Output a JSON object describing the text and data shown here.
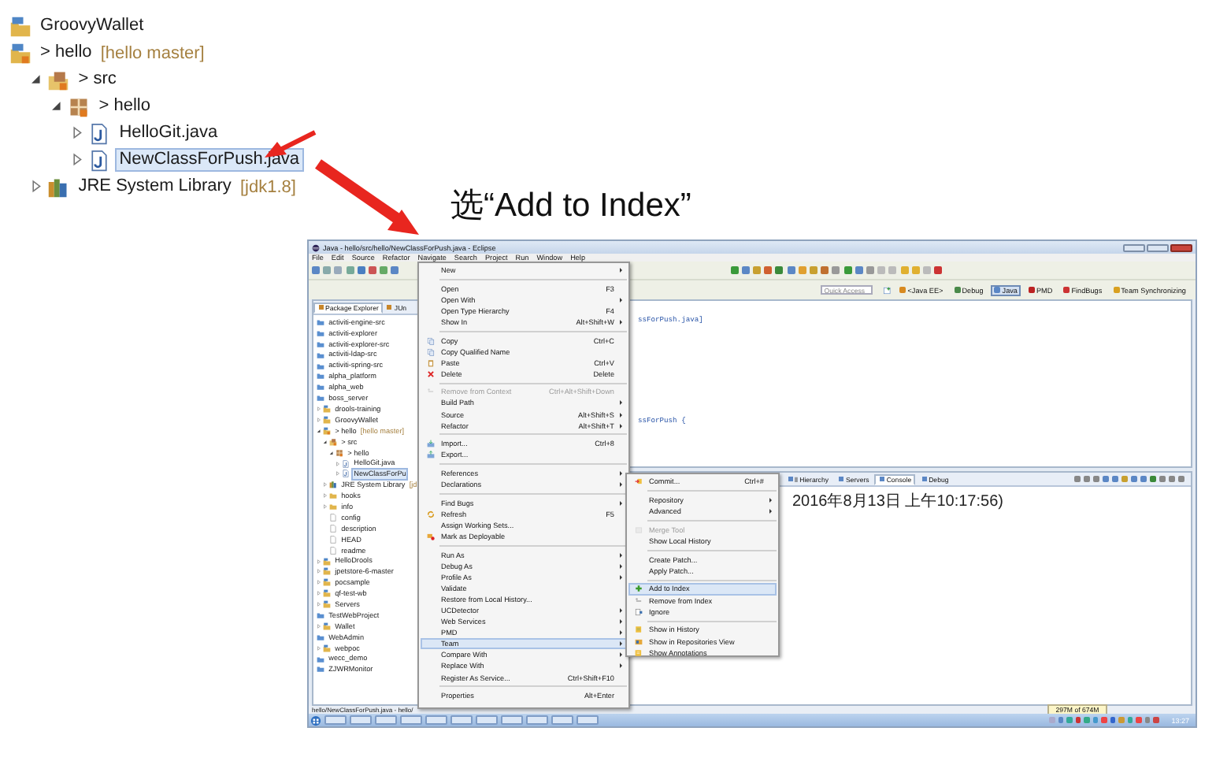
{
  "tree": [
    {
      "kind": "project",
      "label": "GroovyWallet",
      "selected": false
    },
    {
      "kind": "git-project",
      "label": "> hello",
      "decoration": "[hello master]",
      "selected": false,
      "children": [
        {
          "kind": "source-folder",
          "label": "> src",
          "expanded": true,
          "selected": false,
          "children": [
            {
              "kind": "package",
              "label": "> hello",
              "expanded": true,
              "selected": false,
              "children": [
                {
                  "kind": "java-file",
                  "label": "HelloGit.java",
                  "expanded": false,
                  "selected": false
                },
                {
                  "kind": "java-file",
                  "label": "NewClassForPush.java",
                  "expanded": false,
                  "selected": true
                }
              ]
            }
          ]
        },
        {
          "kind": "library",
          "label": "JRE System Library",
          "decoration": "[jdk1.8]",
          "expanded": false,
          "selected": false
        }
      ]
    }
  ],
  "caption": "选“Add to Index”",
  "eclipse": {
    "title": "Java - hello/src/hello/NewClassForPush.java - Eclipse",
    "menubar": [
      "File",
      "Edit",
      "Source",
      "Refactor",
      "Navigate",
      "Search",
      "Project",
      "Run",
      "Window",
      "Help"
    ],
    "quick_access": {
      "placeholder": "Quick Access"
    },
    "perspectives": [
      {
        "label": "<Java EE>",
        "selected": false
      },
      {
        "label": "Debug",
        "selected": false
      },
      {
        "label": "Java",
        "selected": true
      },
      {
        "label": "PMD",
        "selected": false
      },
      {
        "label": "FindBugs",
        "selected": false
      },
      {
        "label": "Team Synchronizing",
        "selected": false
      }
    ],
    "explorer_tabs": [
      {
        "label": "Package Explorer",
        "selected": true
      },
      {
        "label": "JUn",
        "selected": false
      }
    ],
    "explorer": [
      {
        "kind": "closed-project",
        "label": "activiti-engine-src",
        "selected": false
      },
      {
        "kind": "closed-project",
        "label": "activiti-explorer",
        "selected": false
      },
      {
        "kind": "closed-project",
        "label": "activiti-explorer-src",
        "selected": false
      },
      {
        "kind": "closed-project",
        "label": "activiti-ldap-src",
        "selected": false
      },
      {
        "kind": "closed-project",
        "label": "activiti-spring-src",
        "selected": false
      },
      {
        "kind": "closed-project",
        "label": "alpha_platform",
        "selected": false
      },
      {
        "kind": "closed-project",
        "label": "alpha_web",
        "selected": false
      },
      {
        "kind": "closed-project",
        "label": "boss_server",
        "selected": false
      },
      {
        "kind": "project",
        "label": "drools-training",
        "expanded": false,
        "selected": false
      },
      {
        "kind": "project",
        "label": "GroovyWallet",
        "expanded": false,
        "selected": false
      },
      {
        "kind": "git-project",
        "label": "> hello",
        "decoration": "[hello master]",
        "expanded": true,
        "selected": false,
        "children": [
          {
            "kind": "source-folder",
            "label": "> src",
            "expanded": true,
            "selected": false,
            "children": [
              {
                "kind": "package",
                "label": "> hello",
                "expanded": true,
                "selected": false,
                "children": [
                  {
                    "kind": "java-file",
                    "label": "HelloGit.java",
                    "expanded": false,
                    "selected": false
                  },
                  {
                    "kind": "java-file",
                    "label": "NewClassForPu",
                    "expanded": false,
                    "selected": true
                  }
                ]
              }
            ]
          },
          {
            "kind": "library",
            "label": "JRE System Library",
            "decoration": "[jd",
            "expanded": false,
            "selected": false
          },
          {
            "kind": "folder",
            "label": "hooks",
            "expanded": false,
            "selected": false
          },
          {
            "kind": "folder",
            "label": "info",
            "expanded": false,
            "selected": false
          },
          {
            "kind": "file",
            "label": "config",
            "selected": false
          },
          {
            "kind": "file",
            "label": "description",
            "selected": false
          },
          {
            "kind": "file",
            "label": "HEAD",
            "selected": false
          },
          {
            "kind": "file",
            "label": "readme",
            "selected": false
          }
        ]
      },
      {
        "kind": "project",
        "label": "HelloDrools",
        "expanded": false,
        "selected": false
      },
      {
        "kind": "project",
        "label": "jpetstore-6-master",
        "expanded": false,
        "selected": false
      },
      {
        "kind": "project",
        "label": "pocsample",
        "expanded": false,
        "selected": false
      },
      {
        "kind": "project",
        "label": "qf-test-wb",
        "expanded": false,
        "selected": false
      },
      {
        "kind": "project",
        "label": "Servers",
        "expanded": false,
        "selected": false
      },
      {
        "kind": "closed-project",
        "label": "TestWebProject",
        "selected": false
      },
      {
        "kind": "project",
        "label": "Wallet",
        "expanded": false,
        "selected": false
      },
      {
        "kind": "closed-project",
        "label": "WebAdmin",
        "selected": false
      },
      {
        "kind": "project",
        "label": "webpoc",
        "expanded": false,
        "selected": false
      },
      {
        "kind": "closed-project",
        "label": "wecc_demo",
        "selected": false
      },
      {
        "kind": "closed-project",
        "label": "ZJWRMonitor",
        "selected": false
      }
    ],
    "editor_lines": [
      "ssForPush.java]",
      "ssForPush {"
    ],
    "console_tabs": [
      {
        "label": "ll Hierarchy",
        "selected": false
      },
      {
        "label": "Servers",
        "selected": false
      },
      {
        "label": "Console",
        "selected": true
      },
      {
        "label": "Debug",
        "selected": false
      }
    ],
    "console_text": "2016年8月13日 上午10:17:56)",
    "status_text": "hello/NewClassForPush.java - hello/",
    "memory": "297M of 674M",
    "clock": "13:27",
    "context_menu": [
      [
        {
          "label": "New",
          "submenu": true,
          "disabled": false,
          "selected": false
        }
      ],
      [
        {
          "label": "Open",
          "shortcut": "F3",
          "submenu": false,
          "disabled": false,
          "selected": false
        },
        {
          "label": "Open With",
          "submenu": true,
          "disabled": false,
          "selected": false
        },
        {
          "label": "Open Type Hierarchy",
          "shortcut": "F4",
          "submenu": false,
          "disabled": false,
          "selected": false
        },
        {
          "label": "Show In",
          "shortcut": "Alt+Shift+W",
          "submenu": true,
          "disabled": false,
          "selected": false
        }
      ],
      [
        {
          "label": "Copy",
          "shortcut": "Ctrl+C",
          "kind": "copy",
          "submenu": false,
          "disabled": false,
          "selected": false
        },
        {
          "label": "Copy Qualified Name",
          "kind": "copy",
          "submenu": false,
          "disabled": false,
          "selected": false
        },
        {
          "label": "Paste",
          "shortcut": "Ctrl+V",
          "kind": "paste",
          "submenu": false,
          "disabled": false,
          "selected": false
        },
        {
          "label": "Delete",
          "shortcut": "Delete",
          "kind": "delete",
          "submenu": false,
          "disabled": false,
          "selected": false
        }
      ],
      [
        {
          "label": "Remove from Context",
          "shortcut": "Ctrl+Alt+Shift+Down",
          "kind": "remove",
          "submenu": false,
          "disabled": true,
          "selected": false
        },
        {
          "label": "Build Path",
          "submenu": true,
          "disabled": false,
          "selected": false
        },
        {
          "label": "Source",
          "shortcut": "Alt+Shift+S",
          "submenu": true,
          "disabled": false,
          "selected": false
        },
        {
          "label": "Refactor",
          "shortcut": "Alt+Shift+T",
          "submenu": true,
          "disabled": false,
          "selected": false
        }
      ],
      [
        {
          "label": "Import...",
          "shortcut": "Ctrl+8",
          "kind": "import",
          "submenu": false,
          "disabled": false,
          "selected": false
        },
        {
          "label": "Export...",
          "kind": "export",
          "submenu": false,
          "disabled": false,
          "selected": false
        }
      ],
      [
        {
          "label": "References",
          "submenu": true,
          "disabled": false,
          "selected": false
        },
        {
          "label": "Declarations",
          "submenu": true,
          "disabled": false,
          "selected": false
        }
      ],
      [
        {
          "label": "Find Bugs",
          "submenu": true,
          "disabled": false,
          "selected": false
        },
        {
          "label": "Refresh",
          "shortcut": "F5",
          "kind": "refresh",
          "submenu": false,
          "disabled": false,
          "selected": false
        },
        {
          "label": "Assign Working Sets...",
          "submenu": false,
          "disabled": false,
          "selected": false
        },
        {
          "label": "Mark as Deployable",
          "kind": "deploy",
          "submenu": false,
          "disabled": false,
          "selected": false
        }
      ],
      [
        {
          "label": "Run As",
          "submenu": true,
          "disabled": false,
          "selected": false
        },
        {
          "label": "Debug As",
          "submenu": true,
          "disabled": false,
          "selected": false
        },
        {
          "label": "Profile As",
          "submenu": true,
          "disabled": false,
          "selected": false
        },
        {
          "label": "Validate",
          "submenu": false,
          "disabled": false,
          "selected": false
        },
        {
          "label": "Restore from Local History...",
          "submenu": false,
          "disabled": false,
          "selected": false
        },
        {
          "label": "UCDetector",
          "submenu": true,
          "disabled": false,
          "selected": false
        },
        {
          "label": "Web Services",
          "submenu": true,
          "disabled": false,
          "selected": false
        },
        {
          "label": "PMD",
          "submenu": true,
          "disabled": false,
          "selected": false
        },
        {
          "label": "Team",
          "submenu": true,
          "disabled": false,
          "selected": true
        },
        {
          "label": "Compare With",
          "submenu": true,
          "disabled": false,
          "selected": false
        },
        {
          "label": "Replace With",
          "submenu": true,
          "disabled": false,
          "selected": false
        },
        {
          "label": "Register As Service...",
          "shortcut": "Ctrl+Shift+F10",
          "submenu": false,
          "disabled": false,
          "selected": false
        }
      ],
      [
        {
          "label": "Properties",
          "shortcut": "Alt+Enter",
          "submenu": false,
          "disabled": false,
          "selected": false
        }
      ]
    ],
    "team_menu": [
      [
        {
          "label": "Commit...",
          "shortcut": "Ctrl+#",
          "kind": "commit",
          "submenu": false,
          "disabled": false,
          "selected": false
        }
      ],
      [
        {
          "label": "Repository",
          "submenu": true,
          "disabled": false,
          "selected": false
        },
        {
          "label": "Advanced",
          "submenu": true,
          "disabled": false,
          "selected": false
        }
      ],
      [
        {
          "label": "Merge Tool",
          "kind": "merge",
          "submenu": false,
          "disabled": true,
          "selected": false
        },
        {
          "label": "Show Local History",
          "submenu": false,
          "disabled": false,
          "selected": false
        }
      ],
      [
        {
          "label": "Create Patch...",
          "submenu": false,
          "disabled": false,
          "selected": false
        },
        {
          "label": "Apply Patch...",
          "submenu": false,
          "disabled": false,
          "selected": false
        }
      ],
      [
        {
          "label": "Add to Index",
          "kind": "add",
          "submenu": false,
          "disabled": false,
          "selected": true
        },
        {
          "label": "Remove from Index",
          "kind": "remove",
          "submenu": false,
          "disabled": false,
          "selected": false
        },
        {
          "label": "Ignore",
          "kind": "ignore",
          "submenu": false,
          "disabled": false,
          "selected": false
        }
      ],
      [
        {
          "label": "Show in History",
          "kind": "history",
          "submenu": false,
          "disabled": false,
          "selected": false
        },
        {
          "label": "Show in Repositories View",
          "kind": "repository",
          "submenu": false,
          "disabled": false,
          "selected": false
        },
        {
          "label": "Show Annotations",
          "kind": "annotate",
          "submenu": false,
          "disabled": false,
          "selected": false
        }
      ]
    ]
  }
}
